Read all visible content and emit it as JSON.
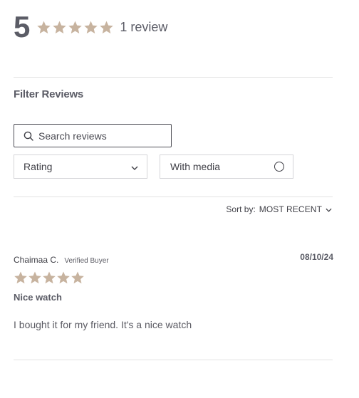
{
  "summary": {
    "average": "5",
    "rating_value": 5,
    "rating_max": 5,
    "review_count_label": "1 review"
  },
  "filters": {
    "title": "Filter Reviews",
    "search_placeholder": "Search reviews",
    "rating_label": "Rating",
    "media_label": "With media"
  },
  "sort": {
    "label": "Sort by:",
    "value": "MOST RECENT"
  },
  "reviews": [
    {
      "author": "Chaimaa C.",
      "badge": "Verified Buyer",
      "date": "08/10/24",
      "rating": 5,
      "title": "Nice watch",
      "body": "I bought it for my friend. It's a nice watch"
    }
  ],
  "colors": {
    "star": "#c7b39f",
    "text_dark": "#5b5c66",
    "divider": "#e3e3e3"
  },
  "icons": {
    "search": "search-icon",
    "chevron": "chevron-down-icon",
    "star": "star-icon",
    "radio": "radio-icon"
  }
}
